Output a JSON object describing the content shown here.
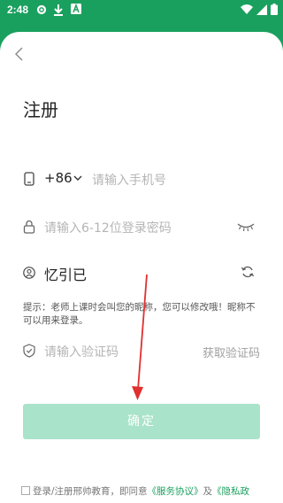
{
  "status_bar": {
    "time": "2:48",
    "icons": [
      "gear-icon",
      "download-icon",
      "text-notification-icon",
      "wifi-icon",
      "signal-icon",
      "battery-icon"
    ]
  },
  "header": {
    "back_icon": "chevron-left-icon",
    "title": "注册"
  },
  "form": {
    "phone": {
      "icon": "phone-icon",
      "country_code": "+86",
      "placeholder": "请输入手机号"
    },
    "password": {
      "icon": "lock-icon",
      "placeholder": "请输入6-12位登录密码",
      "toggle_icon": "eye-closed-icon"
    },
    "nickname": {
      "icon": "user-icon",
      "value": "忆引已",
      "refresh_icon": "refresh-icon"
    },
    "hint": "提示：老师上课时会叫您的昵称，您可以修改哦！昵称不可以用来登录。",
    "verification": {
      "icon": "shield-icon",
      "placeholder": "请输入验证码",
      "get_code_label": "获取验证码"
    },
    "confirm_label": "确定"
  },
  "agreement": {
    "prefix": "登录/注册邢帅教育，即同意",
    "service_link": "《服务协议》",
    "and": "及",
    "privacy_link": "《隐私政"
  },
  "colors": {
    "brand_green": "#1aa05e",
    "button_disabled": "#a9e3c9",
    "annotation_arrow": "#e03030"
  }
}
